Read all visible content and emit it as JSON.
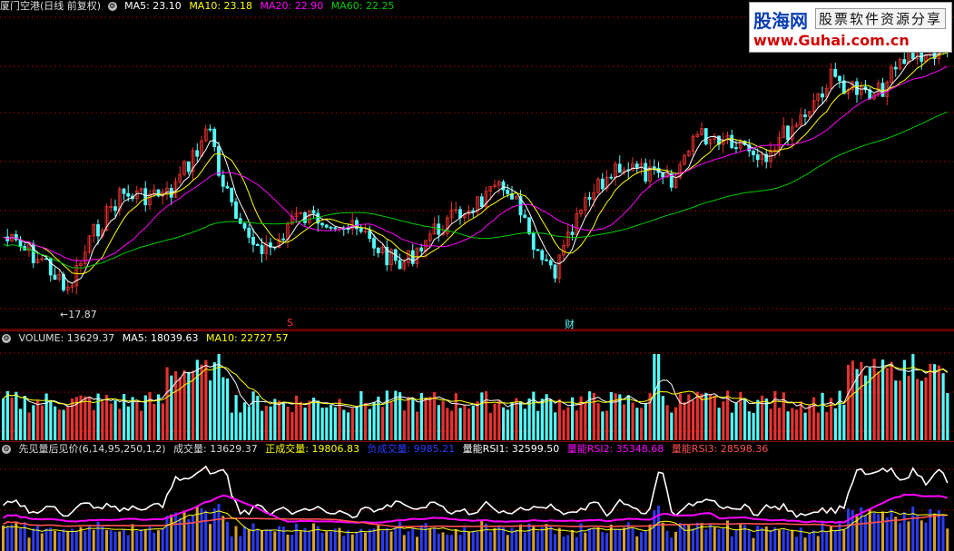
{
  "price_panel": {
    "stock_name": "厦门空港(日线 前复权)",
    "ma5": "MA5: 23.10",
    "ma10": "MA10: 23.18",
    "ma20": "MA20: 22.90",
    "ma60": "MA60: 22.25",
    "low_label": "←17.87",
    "event_marker_1": "S",
    "event_marker_2": "财"
  },
  "volume_panel": {
    "volume": "VOLUME: 13629.37",
    "ma5": "MA5: 18039.63",
    "ma10": "MA10: 22727.57"
  },
  "indicator_panel": {
    "name": "先见量后见价(6,14,95,250,1,2)",
    "chengjiaoliang": "成交量: 13629.37",
    "zheng": "正成交量: 19806.83",
    "fu": "负成交量: 9985.21",
    "rsi1": "量能RSI1: 32599.50",
    "rsi2": "量能RSI2: 35348.68",
    "rsi3": "量能RSI3: 28598.36"
  },
  "watermark": {
    "brand": "股海网",
    "tagline": "股票软件资源分享",
    "url": "www.Guhai.com.cn"
  },
  "colors": {
    "up": "#e8322f",
    "down": "#54ffff",
    "ma5": "#ffffff",
    "ma10": "#ffff00",
    "ma20": "#ff00ff",
    "ma60": "#00cc00",
    "grid": "#8a0000",
    "rsi1": "#ffffff",
    "rsi2": "#ff00ff",
    "rsi3": "#ff5050",
    "neg_bar": "#2a3cff"
  }
}
